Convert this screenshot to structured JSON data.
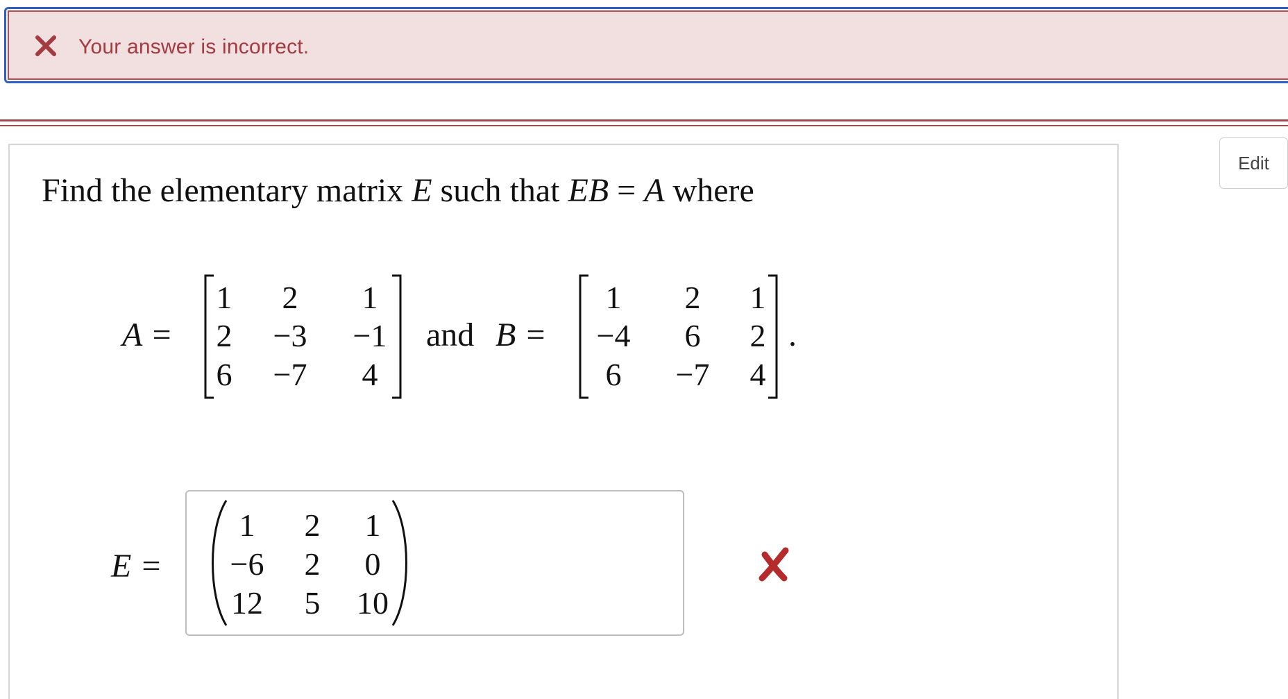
{
  "feedback": {
    "message": "Your answer is incorrect.",
    "icon": "close-icon",
    "color": "#a33b41",
    "background": "#f2e0e1"
  },
  "edit_button": {
    "label": "Edit"
  },
  "question": {
    "prefix": "Find the elementary matrix ",
    "var_e": "E",
    "middle": " such that ",
    "var_eb": "EB",
    "equals": " = ",
    "var_a": "A",
    "suffix": " where"
  },
  "matrix_a": {
    "label": "A =",
    "rows": [
      [
        "1",
        "2",
        "1"
      ],
      [
        "2",
        "−3",
        "−1"
      ],
      [
        "6",
        "−7",
        "4"
      ]
    ]
  },
  "conjunction": "and",
  "matrix_b": {
    "label": "B =",
    "rows": [
      [
        "1",
        "2",
        "1"
      ],
      [
        "−4",
        "6",
        "2"
      ],
      [
        "6",
        "−7",
        "4"
      ]
    ],
    "trailing": "."
  },
  "answer": {
    "label": "E =",
    "rows": [
      [
        "1",
        "2",
        "1"
      ],
      [
        "−6",
        "2",
        "0"
      ],
      [
        "12",
        "5",
        "10"
      ]
    ],
    "status": "incorrect",
    "status_color": "#b52a2a"
  }
}
